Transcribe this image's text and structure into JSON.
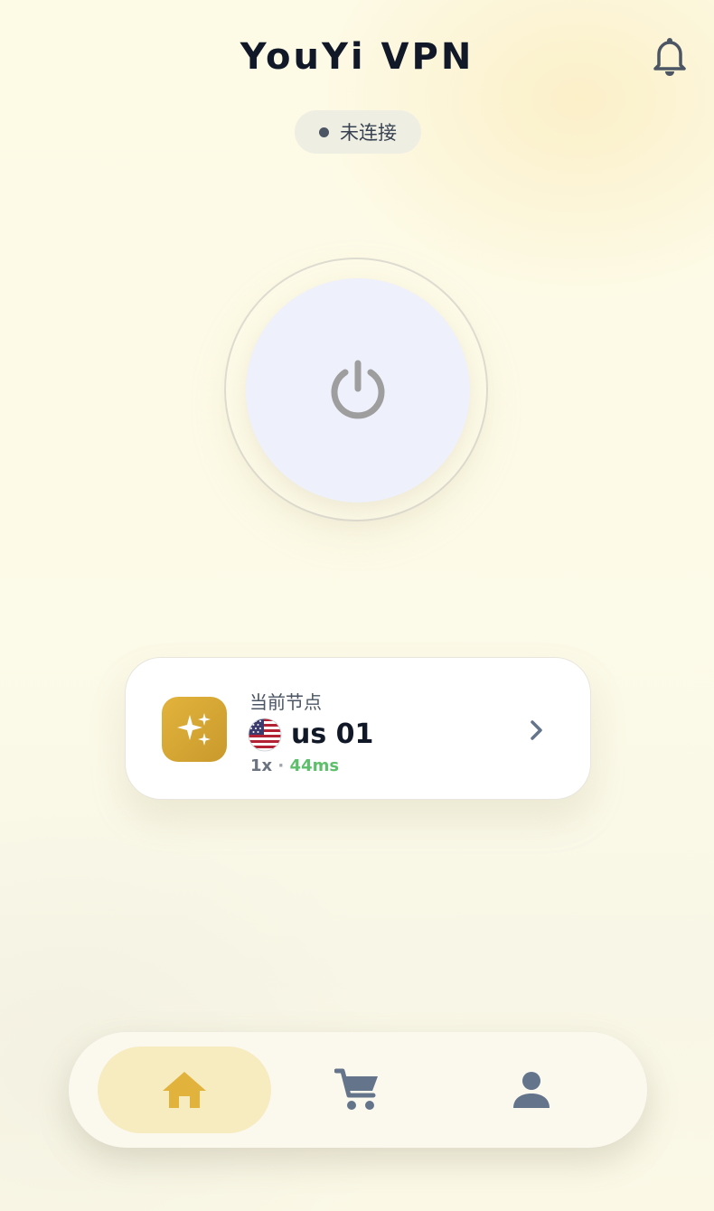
{
  "header": {
    "title": "YouYi VPN"
  },
  "status": {
    "text": "未连接"
  },
  "node": {
    "label": "当前节点",
    "name": "us 01",
    "multiplier": "1x",
    "separator": "·",
    "latency": "44ms"
  },
  "icons": {
    "notification": "bell-icon",
    "power": "power-icon",
    "node": "sparkles-icon",
    "flag": "us-flag-icon",
    "chevron": "chevron-right-icon",
    "home": "home-icon",
    "shop": "cart-icon",
    "profile": "user-icon"
  },
  "colors": {
    "accent": "#e2b33c",
    "latency": "#5cbf6a",
    "icon_inactive": "#64748b",
    "power_icon": "#9e9e9e"
  }
}
